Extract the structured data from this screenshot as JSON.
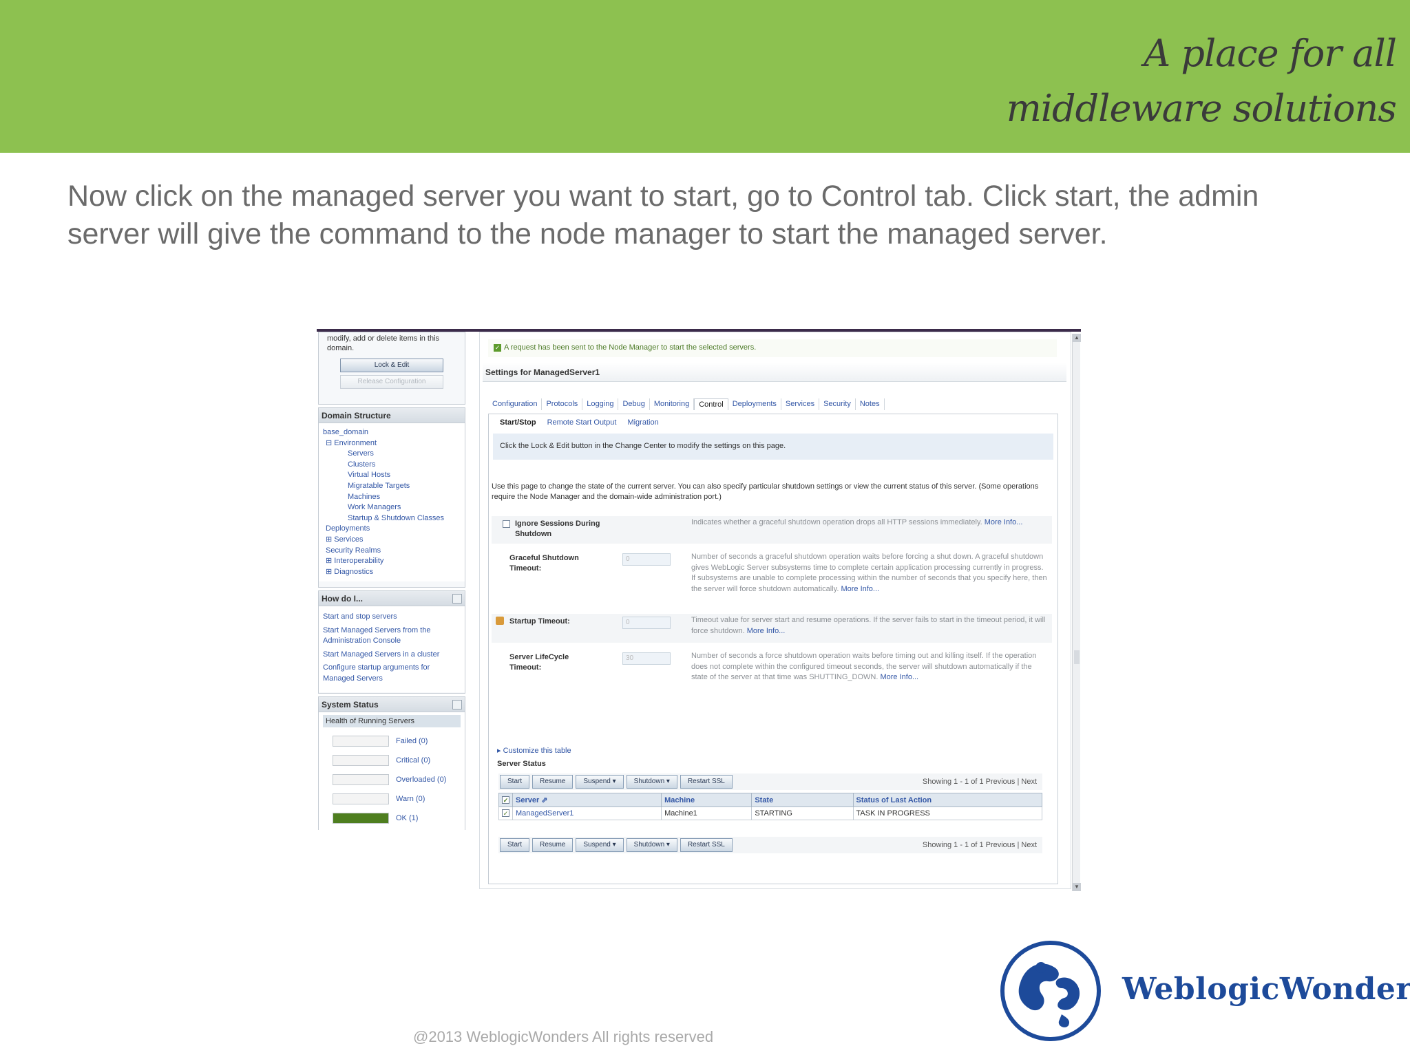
{
  "header": {
    "tagline_line1": "A place for all",
    "tagline_line2": "middleware solutions",
    "band_color": "#8dc150"
  },
  "instruction": "Now click on the managed server you want to start, go to Control tab. Click start, the admin server will give the command to the node manager to start the managed server.",
  "console": {
    "change_center": {
      "text": "modify, add or delete items in this domain.",
      "lock_button": "Lock & Edit",
      "release_button": "Release Configuration"
    },
    "domain_structure": {
      "title": "Domain Structure",
      "items": [
        {
          "label": "base_domain",
          "level": 0
        },
        {
          "label": "⊟ Environment",
          "level": 1
        },
        {
          "label": "Servers",
          "level": 2
        },
        {
          "label": "Clusters",
          "level": 2
        },
        {
          "label": "Virtual Hosts",
          "level": 2
        },
        {
          "label": "Migratable Targets",
          "level": 2
        },
        {
          "label": "Machines",
          "level": 2
        },
        {
          "label": "Work Managers",
          "level": 2
        },
        {
          "label": "Startup & Shutdown Classes",
          "level": 2
        },
        {
          "label": "Deployments",
          "level": 1
        },
        {
          "label": "⊞ Services",
          "level": 1
        },
        {
          "label": "Security Realms",
          "level": 1
        },
        {
          "label": "⊞ Interoperability",
          "level": 1
        },
        {
          "label": "⊞ Diagnostics",
          "level": 1
        }
      ]
    },
    "how_do_i": {
      "title": "How do I...",
      "items": [
        "Start and stop servers",
        "Start Managed Servers from the Administration Console",
        "Start Managed Servers in a cluster",
        "Configure startup arguments for Managed Servers"
      ]
    },
    "system_status": {
      "title": "System Status",
      "health_title": "Health of Running Servers",
      "rows": [
        {
          "label": "Failed (0)",
          "fraction": 0.0
        },
        {
          "label": "Critical (0)",
          "fraction": 0.0
        },
        {
          "label": "Overloaded (0)",
          "fraction": 0.0
        },
        {
          "label": "Warn (0)",
          "fraction": 0.0
        },
        {
          "label": "OK (1)",
          "fraction": 1.0
        }
      ]
    },
    "message": "A request has been sent to the Node Manager to start the selected servers.",
    "settings_title": "Settings for ManagedServer1",
    "tabs": [
      "Configuration",
      "Protocols",
      "Logging",
      "Debug",
      "Monitoring",
      "Control",
      "Deployments",
      "Services",
      "Security",
      "Notes"
    ],
    "active_tab": "Control",
    "subtabs": [
      "Start/Stop",
      "Remote Start Output",
      "Migration"
    ],
    "note": "Click the Lock & Edit button in the Change Center to modify the settings on this page.",
    "description": "Use this page to change the state of the current server. You can also specify particular shutdown settings or view the current status of this server. (Some operations require the Node Manager and the domain-wide administration port.)",
    "fields": [
      {
        "label": "Ignore Sessions During Shutdown",
        "value": "",
        "help": "Indicates whether a graceful shutdown operation drops all HTTP sessions immediately.",
        "more": "More Info..."
      },
      {
        "label": "Graceful Shutdown Timeout:",
        "value": "0",
        "help": "Number of seconds a graceful shutdown operation waits before forcing a shut down. A graceful shutdown gives WebLogic Server subsystems time to complete certain application processing currently in progress. If subsystems are unable to complete processing within the number of seconds that you specify here, then the server will force shutdown automatically.",
        "more": "More Info..."
      },
      {
        "label": "Startup Timeout:",
        "value": "0",
        "help": "Timeout value for server start and resume operations. If the server fails to start in the timeout period, it will force shutdown.",
        "more": "More Info..."
      },
      {
        "label": "Server LifeCycle Timeout:",
        "value": "30",
        "help": "Number of seconds a force shutdown operation waits before timing out and killing itself. If the operation does not complete within the configured timeout seconds, the server will shutdown automatically if the state of the server at that time was SHUTTING_DOWN.",
        "more": "More Info..."
      }
    ],
    "customize": "Customize this table",
    "server_status_title": "Server Status",
    "toolbar": [
      "Start",
      "Resume",
      "Suspend ▾",
      "Shutdown ▾",
      "Restart SSL"
    ],
    "paging": "Showing 1 - 1 of 1   Previous | Next",
    "table": {
      "headers": [
        "Server ⇗",
        "Machine",
        "State",
        "Status of Last Action"
      ],
      "rows": [
        [
          "ManagedServer1",
          "Machine1",
          "STARTING",
          "TASK IN PROGRESS"
        ]
      ]
    }
  },
  "footer": {
    "copyright": "@2013 WeblogicWonders All rights reserved",
    "brand": "WeblogicWonders",
    "brand_color": "#1d4a9a"
  }
}
